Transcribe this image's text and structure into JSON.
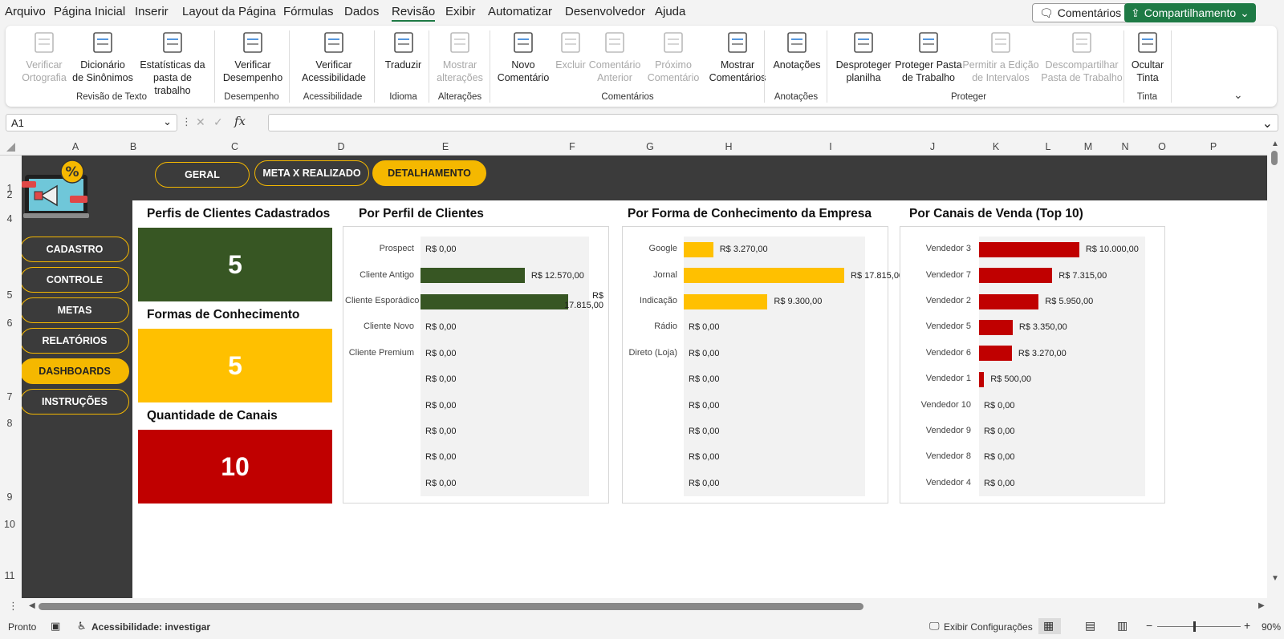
{
  "menu": {
    "items": [
      "Arquivo",
      "Página Inicial",
      "Inserir",
      "Layout da Página",
      "Fórmulas",
      "Dados",
      "Revisão",
      "Exibir",
      "Automatizar",
      "Desenvolvedor",
      "Ajuda"
    ],
    "active": "Revisão",
    "comments": "Comentários",
    "share": "Compartilhamento"
  },
  "ribbon": {
    "buttons": [
      {
        "l1": "Verificar",
        "l2": "Ortografia",
        "disabled": true,
        "icon": "spelling-icon"
      },
      {
        "l1": "Dicionário",
        "l2": "de Sinônimos",
        "disabled": false,
        "icon": "thesaurus-icon"
      },
      {
        "l1": "Estatísticas da",
        "l2": "pasta de trabalho",
        "disabled": false,
        "icon": "workbook-stats-icon"
      },
      {
        "l1": "Verificar",
        "l2": "Desempenho",
        "disabled": false,
        "icon": "performance-icon"
      },
      {
        "l1": "Verificar",
        "l2": "Acessibilidade",
        "disabled": false,
        "icon": "accessibility-icon"
      },
      {
        "l1": "Traduzir",
        "l2": "",
        "disabled": false,
        "icon": "translate-icon"
      },
      {
        "l1": "Mostrar",
        "l2": "alterações",
        "disabled": true,
        "icon": "show-changes-icon"
      },
      {
        "l1": "Novo",
        "l2": "Comentário",
        "disabled": false,
        "icon": "new-comment-icon"
      },
      {
        "l1": "Excluir",
        "l2": "",
        "disabled": true,
        "icon": "delete-comment-icon"
      },
      {
        "l1": "Comentário",
        "l2": "Anterior",
        "disabled": true,
        "icon": "previous-comment-icon"
      },
      {
        "l1": "Próximo",
        "l2": "Comentário",
        "disabled": true,
        "icon": "next-comment-icon"
      },
      {
        "l1": "Mostrar",
        "l2": "Comentários",
        "disabled": false,
        "icon": "show-comments-icon"
      },
      {
        "l1": "Anotações",
        "l2": "",
        "disabled": false,
        "icon": "notes-icon"
      },
      {
        "l1": "Desproteger",
        "l2": "planilha",
        "disabled": false,
        "icon": "unprotect-sheet-icon"
      },
      {
        "l1": "Proteger Pasta",
        "l2": "de Trabalho",
        "disabled": false,
        "icon": "protect-workbook-icon"
      },
      {
        "l1": "Permitir a Edição",
        "l2": "de Intervalos",
        "disabled": true,
        "icon": "allow-edit-ranges-icon"
      },
      {
        "l1": "Descompartilhar",
        "l2": "Pasta de Trabalho",
        "disabled": true,
        "icon": "unshare-workbook-icon"
      },
      {
        "l1": "Ocultar",
        "l2": "Tinta",
        "disabled": false,
        "icon": "hide-ink-icon"
      }
    ],
    "groups": [
      "Revisão de Texto",
      "Desempenho",
      "Acessibilidade",
      "Idioma",
      "Alterações",
      "Comentários",
      "Anotações",
      "Proteger",
      "Tinta"
    ]
  },
  "formula_bar": {
    "name_box": "A1",
    "fx": "fx",
    "value": ""
  },
  "columns": [
    "A",
    "B",
    "C",
    "D",
    "E",
    "F",
    "G",
    "H",
    "I",
    "J",
    "K",
    "L",
    "M",
    "N",
    "O",
    "P"
  ],
  "rows": [
    "1",
    "2",
    "4",
    "5",
    "6",
    "7",
    "8",
    "9",
    "10",
    "11"
  ],
  "nav_top": [
    "GERAL",
    "META X REALIZADO",
    "DETALHAMENTO"
  ],
  "nav_side": [
    "CADASTRO",
    "CONTROLE",
    "METAS",
    "RELATÓRIOS",
    "DASHBOARDS",
    "INSTRUÇÕES"
  ],
  "kpis": [
    {
      "title": "Perfis de Clientes Cadastrados",
      "value": "5",
      "color": "#375623"
    },
    {
      "title": "Formas de Conhecimento",
      "value": "5",
      "color": "#ffc000"
    },
    {
      "title": "Quantidade de Canais",
      "value": "10",
      "color": "#c00000"
    }
  ],
  "chart_data": [
    {
      "type": "bar",
      "title": "Por Perfil de Clientes",
      "color": "#375623",
      "categories": [
        "Prospect",
        "Cliente Antigo",
        "Cliente Esporádico",
        "Cliente Novo",
        "Cliente Premium",
        "",
        "",
        "",
        "",
        ""
      ],
      "values": [
        0,
        12570,
        17815,
        0,
        0,
        0,
        0,
        0,
        0,
        0
      ],
      "labels": [
        "R$ 0,00",
        "R$ 12.570,00",
        "R$ 17.815,00",
        "R$ 0,00",
        "R$ 0,00",
        "R$ 0,00",
        "R$ 0,00",
        "R$ 0,00",
        "R$ 0,00",
        "R$ 0,00"
      ],
      "xlim": [
        0,
        17815
      ]
    },
    {
      "type": "bar",
      "title": "Por Forma de Conhecimento da Empresa",
      "color": "#ffc000",
      "categories": [
        "Google",
        "Jornal",
        "Indicação",
        "Rádio",
        "Direto (Loja)",
        "",
        "",
        "",
        "",
        ""
      ],
      "values": [
        3270,
        17815,
        9300,
        0,
        0,
        0,
        0,
        0,
        0,
        0
      ],
      "labels": [
        "R$ 3.270,00",
        "R$ 17.815,00",
        "R$ 9.300,00",
        "R$ 0,00",
        "R$ 0,00",
        "R$ 0,00",
        "R$ 0,00",
        "R$ 0,00",
        "R$ 0,00",
        "R$ 0,00"
      ],
      "xlim": [
        0,
        17815
      ]
    },
    {
      "type": "bar",
      "title": "Por Canais de Venda (Top 10)",
      "color": "#c00000",
      "categories": [
        "Vendedor 3",
        "Vendedor 7",
        "Vendedor 2",
        "Vendedor 5",
        "Vendedor 6",
        "Vendedor 1",
        "Vendedor 10",
        "Vendedor 9",
        "Vendedor 8",
        "Vendedor 4"
      ],
      "values": [
        10000,
        7315,
        5950,
        3350,
        3270,
        500,
        0,
        0,
        0,
        0
      ],
      "labels": [
        "R$ 10.000,00",
        "R$ 7.315,00",
        "R$ 5.950,00",
        "R$ 3.350,00",
        "R$ 3.270,00",
        "R$ 500,00",
        "R$ 0,00",
        "R$ 0,00",
        "R$ 0,00",
        "R$ 0,00"
      ],
      "xlim": [
        0,
        14500
      ]
    }
  ],
  "status": {
    "ready": "Pronto",
    "accessibility": "Acessibilidade: investigar",
    "display_settings": "Exibir Configurações",
    "zoom": "90%"
  }
}
